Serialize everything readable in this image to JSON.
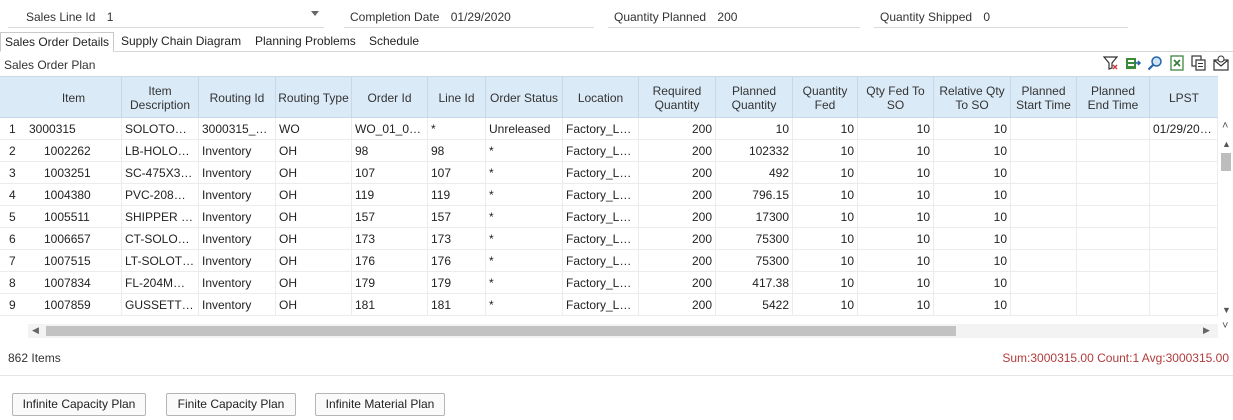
{
  "header": {
    "sales_line_id": {
      "label": "Sales Line Id",
      "value": "1"
    },
    "completion_date": {
      "label": "Completion Date",
      "value": "01/29/2020"
    },
    "quantity_planned": {
      "label": "Quantity Planned",
      "value": "200"
    },
    "quantity_shipped": {
      "label": "Quantity Shipped",
      "value": "0"
    }
  },
  "tabs": [
    {
      "label": "Sales Order Details",
      "active": true
    },
    {
      "label": "Supply Chain Diagram",
      "active": false
    },
    {
      "label": "Planning Problems",
      "active": false
    },
    {
      "label": "Schedule",
      "active": false
    }
  ],
  "section_title": "Sales Order Plan",
  "toolbar_icons": [
    "filter-icon",
    "export-icon",
    "find-icon",
    "export-excel-icon",
    "copy-icon",
    "email-icon"
  ],
  "grid": {
    "columns": [
      "Item",
      "Item Description",
      "Routing Id",
      "Routing Type",
      "Order Id",
      "Line Id",
      "Order Status",
      "Location",
      "Required Quantity",
      "Planned Quantity",
      "Quantity Fed",
      "Qty Fed To SO",
      "Relative Qty To SO",
      "Planned Start Time",
      "Planned End Time",
      "LPST"
    ],
    "rows": [
      {
        "n": "1",
        "cells": [
          "3000315",
          "SOLOTO…",
          "3000315_…",
          "WO",
          "WO_01_0…",
          "*",
          "Unreleased",
          "Factory_L…",
          "200",
          "10",
          "10",
          "10",
          "10",
          "",
          "",
          "01/29/20…"
        ]
      },
      {
        "n": "2",
        "cells": [
          "1002262",
          "LB-HOLO…",
          "Inventory",
          "OH",
          "98",
          "98",
          "*",
          "Factory_L…",
          "200",
          "102332",
          "10",
          "10",
          "10",
          "",
          "",
          ""
        ]
      },
      {
        "n": "3",
        "cells": [
          "1003251",
          "SC-475X3…",
          "Inventory",
          "OH",
          "107",
          "107",
          "*",
          "Factory_L…",
          "200",
          "492",
          "10",
          "10",
          "10",
          "",
          "",
          ""
        ]
      },
      {
        "n": "4",
        "cells": [
          "1004380",
          "PVC-208…",
          "Inventory",
          "OH",
          "119",
          "119",
          "*",
          "Factory_L…",
          "200",
          "796.15",
          "10",
          "10",
          "10",
          "",
          "",
          ""
        ]
      },
      {
        "n": "5",
        "cells": [
          "1005511",
          "SHIPPER …",
          "Inventory",
          "OH",
          "157",
          "157",
          "*",
          "Factory_L…",
          "200",
          "17300",
          "10",
          "10",
          "10",
          "",
          "",
          ""
        ]
      },
      {
        "n": "6",
        "cells": [
          "1006657",
          "CT-SOLO…",
          "Inventory",
          "OH",
          "173",
          "173",
          "*",
          "Factory_L…",
          "200",
          "75300",
          "10",
          "10",
          "10",
          "",
          "",
          ""
        ]
      },
      {
        "n": "7",
        "cells": [
          "1007515",
          "LT-SOLOT…",
          "Inventory",
          "OH",
          "176",
          "176",
          "*",
          "Factory_L…",
          "200",
          "75300",
          "10",
          "10",
          "10",
          "",
          "",
          ""
        ]
      },
      {
        "n": "8",
        "cells": [
          "1007834",
          "FL-204M…",
          "Inventory",
          "OH",
          "179",
          "179",
          "*",
          "Factory_L…",
          "200",
          "417.38",
          "10",
          "10",
          "10",
          "",
          "",
          ""
        ]
      },
      {
        "n": "9",
        "cells": [
          "1007859",
          "GUSSETT…",
          "Inventory",
          "OH",
          "181",
          "181",
          "*",
          "Factory_L…",
          "200",
          "5422",
          "10",
          "10",
          "10",
          "",
          "",
          ""
        ]
      }
    ]
  },
  "footer": {
    "items_count": "862 Items",
    "summary": "Sum:3000315.00 Count:1 Avg:3000315.00"
  },
  "buttons": {
    "infinite_capacity": "Infinite Capacity Plan",
    "finite_capacity": "Finite Capacity Plan",
    "infinite_material": "Infinite Material Plan"
  }
}
